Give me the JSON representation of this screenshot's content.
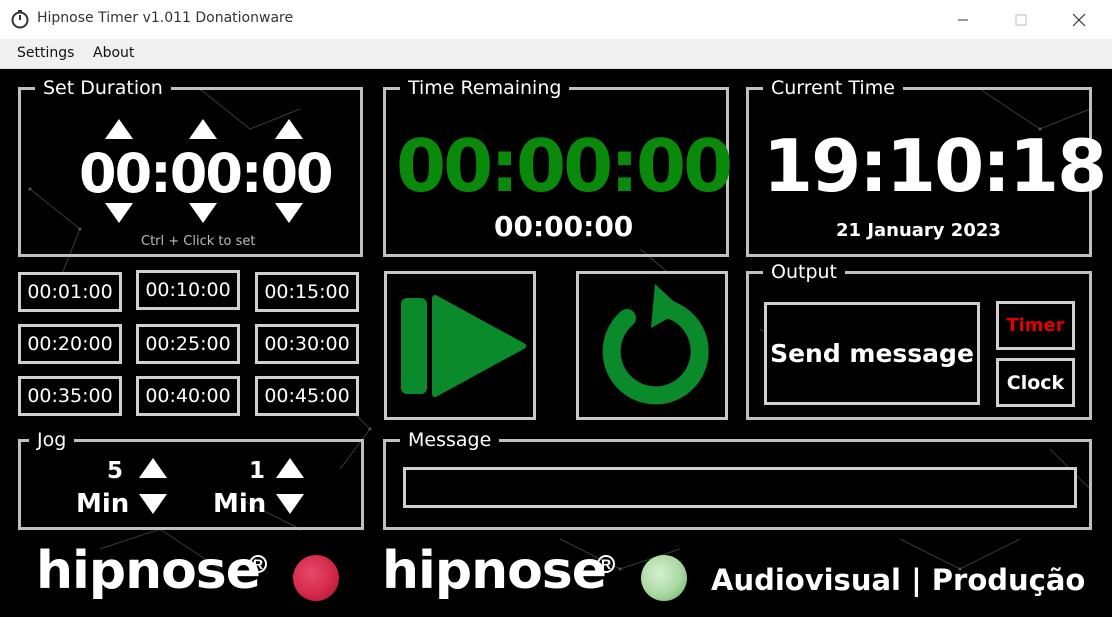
{
  "window": {
    "title": "Hipnose Timer v1.011 Donationware"
  },
  "menu": {
    "items": [
      "Settings",
      "About"
    ]
  },
  "set_duration": {
    "label": "Set Duration",
    "value": "00:00:00",
    "hint": "Ctrl + Click to set"
  },
  "time_remaining": {
    "label": "Time Remaining",
    "value": "00:00:00",
    "sub_value": "00:00:00",
    "color": "#0a8a0a"
  },
  "current_time": {
    "label": "Current Time",
    "value": "19:10:18",
    "date": "21 January 2023"
  },
  "presets": [
    "00:01:00",
    "00:10:00",
    "00:15:00",
    "00:20:00",
    "00:25:00",
    "00:30:00",
    "00:35:00",
    "00:40:00",
    "00:45:00"
  ],
  "controls": {
    "play_icon": "play-pause-icon",
    "reset_icon": "reset-icon",
    "accent": "#0a8a2a"
  },
  "output": {
    "label": "Output",
    "send_label": "Send message",
    "timer_label": "Timer",
    "clock_label": "Clock",
    "timer_color": "#e00000"
  },
  "jog": {
    "label": "Jog",
    "left_amount": "5",
    "left_unit": "Min",
    "right_amount": "1",
    "right_unit": "Min"
  },
  "message": {
    "label": "Message",
    "value": ""
  },
  "footer": {
    "logo1": "hipnose",
    "logo2": "hipnose",
    "reg_mark": "R",
    "tagline": "Audiovisual | Produção",
    "dot1_color": "#d4284a",
    "dot2_color": "#a8d8a0"
  }
}
